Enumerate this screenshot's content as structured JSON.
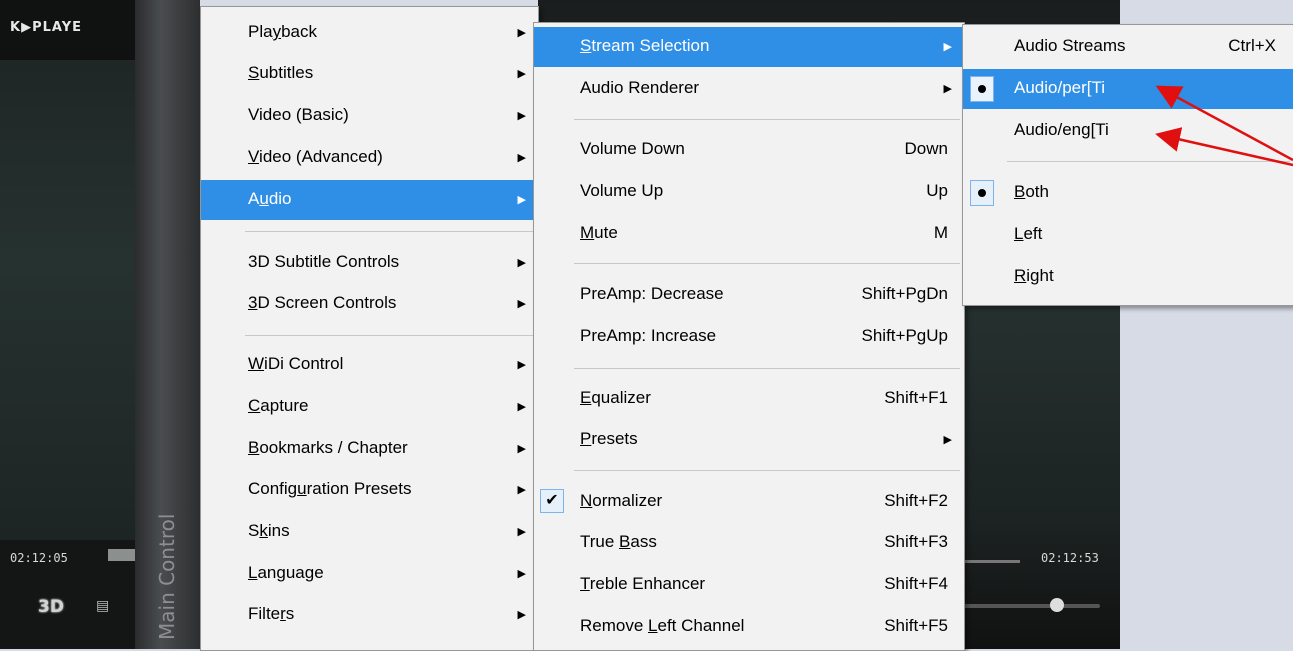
{
  "player": {
    "title": "K▶PLAYE",
    "time_left": "02:12:05",
    "time_right": "02:12:53",
    "btn_3d": "3D",
    "side_label": "Main Control"
  },
  "menu_main": [
    {
      "pre": "Pla",
      "u": "y",
      "post": "back",
      "arrow": true
    },
    {
      "pre": "",
      "u": "S",
      "post": "ubtitles",
      "arrow": true
    },
    {
      "pre": "Video (Basic)",
      "u": "",
      "post": "",
      "arrow": true
    },
    {
      "pre": "",
      "u": "V",
      "post": "ideo (Advanced)",
      "arrow": true
    },
    {
      "pre": "A",
      "u": "u",
      "post": "dio",
      "arrow": true,
      "hl": true
    },
    {
      "pre": "3D Subtitle Controls",
      "u": "",
      "post": "",
      "arrow": true
    },
    {
      "pre": "",
      "u": "3",
      "post": "D Screen Controls",
      "arrow": true
    },
    {
      "pre": "",
      "u": "W",
      "post": "iDi Control",
      "arrow": true
    },
    {
      "pre": "",
      "u": "C",
      "post": "apture",
      "arrow": true
    },
    {
      "pre": "",
      "u": "B",
      "post": "ookmarks / Chapter",
      "arrow": true
    },
    {
      "pre": "Config",
      "u": "u",
      "post": "ration Presets",
      "arrow": true
    },
    {
      "pre": "S",
      "u": "k",
      "post": "ins",
      "arrow": true
    },
    {
      "pre": "",
      "u": "L",
      "post": "anguage",
      "arrow": true
    },
    {
      "pre": "Filte",
      "u": "r",
      "post": "s",
      "arrow": true
    }
  ],
  "menu_audio": [
    {
      "pre": "",
      "u": "S",
      "post": "tream Selection",
      "sc": "",
      "arrow": true,
      "hl": true
    },
    {
      "pre": "Audio Renderer",
      "u": "",
      "post": "",
      "sc": "",
      "arrow": true
    },
    {
      "pre": "Volume Down",
      "u": "",
      "post": "",
      "sc": "Down"
    },
    {
      "pre": "Volume Up",
      "u": "",
      "post": "",
      "sc": "Up"
    },
    {
      "pre": "",
      "u": "M",
      "post": "ute",
      "sc": "M"
    },
    {
      "pre": "PreAmp: Decrease",
      "u": "",
      "post": "",
      "sc": "Shift+PgDn"
    },
    {
      "pre": "PreAmp: Increase",
      "u": "",
      "post": "",
      "sc": "Shift+PgUp"
    },
    {
      "pre": "",
      "u": "E",
      "post": "qualizer",
      "sc": "Shift+F1"
    },
    {
      "pre": "",
      "u": "P",
      "post": "resets",
      "sc": "",
      "arrow": true
    },
    {
      "pre": "",
      "u": "N",
      "post": "ormalizer",
      "sc": "Shift+F2",
      "checked": true
    },
    {
      "pre": "True ",
      "u": "B",
      "post": "ass",
      "sc": "Shift+F3"
    },
    {
      "pre": "",
      "u": "T",
      "post": "reble Enhancer",
      "sc": "Shift+F4"
    },
    {
      "pre": "Remove ",
      "u": "L",
      "post": "eft Channel",
      "sc": "Shift+F5"
    }
  ],
  "menu_stream": [
    {
      "pre": "Audio Streams",
      "u": "",
      "post": "",
      "sc": "Ctrl+X"
    },
    {
      "pre": "Audio/per[Ti",
      "u": "",
      "post": "",
      "sc": "",
      "radio": true,
      "hl": true
    },
    {
      "pre": "Audio/eng[Ti",
      "u": "",
      "post": "",
      "sc": ""
    },
    {
      "pre": "",
      "u": "B",
      "post": "oth",
      "sc": "",
      "radio": true
    },
    {
      "pre": "",
      "u": "L",
      "post": "eft",
      "sc": ""
    },
    {
      "pre": "",
      "u": "R",
      "post": "ight",
      "sc": ""
    }
  ],
  "colors": {
    "highlight": "#2f8fe6",
    "arrow_annotation": "#e01010"
  }
}
